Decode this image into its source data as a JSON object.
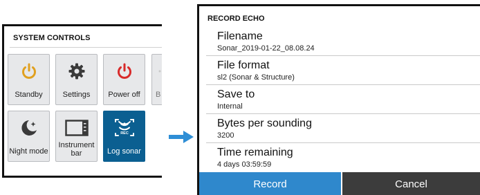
{
  "system_controls": {
    "title": "SYSTEM CONTROLS",
    "tiles": [
      {
        "label": "Standby",
        "icon": "standby-icon",
        "color": "#e0a020"
      },
      {
        "label": "Settings",
        "icon": "gear-icon",
        "color": "#3c3c3c"
      },
      {
        "label": "Power off",
        "icon": "power-icon",
        "color": "#d82a2a"
      },
      {
        "label": "B",
        "icon": "brightness-icon",
        "color": "#c9c9c9"
      },
      {
        "label": "Night mode",
        "icon": "night-mode-icon",
        "color": "#3c3c3c"
      },
      {
        "label": "Instrument bar",
        "icon": "instrument-bar-icon",
        "color": "#3c3c3c"
      },
      {
        "label": "Log sonar",
        "icon": "log-sonar-icon",
        "color": "#ffffff",
        "active": true
      }
    ]
  },
  "record_echo": {
    "title": "RECORD ECHO",
    "fields": [
      {
        "label": "Filename",
        "value": "Sonar_2019-01-22_08.08.24"
      },
      {
        "label": "File format",
        "value": "sl2 (Sonar & Structure)"
      },
      {
        "label": "Save to",
        "value": "Internal"
      },
      {
        "label": "Bytes per sounding",
        "value": "3200"
      },
      {
        "label": "Time remaining",
        "value": "4 days 03:59:59"
      }
    ],
    "record_label": "Record",
    "cancel_label": "Cancel"
  },
  "colors": {
    "accent_blue": "#2f88cc",
    "active_tile": "#0b5f91",
    "arrow": "#2e8ed6"
  }
}
